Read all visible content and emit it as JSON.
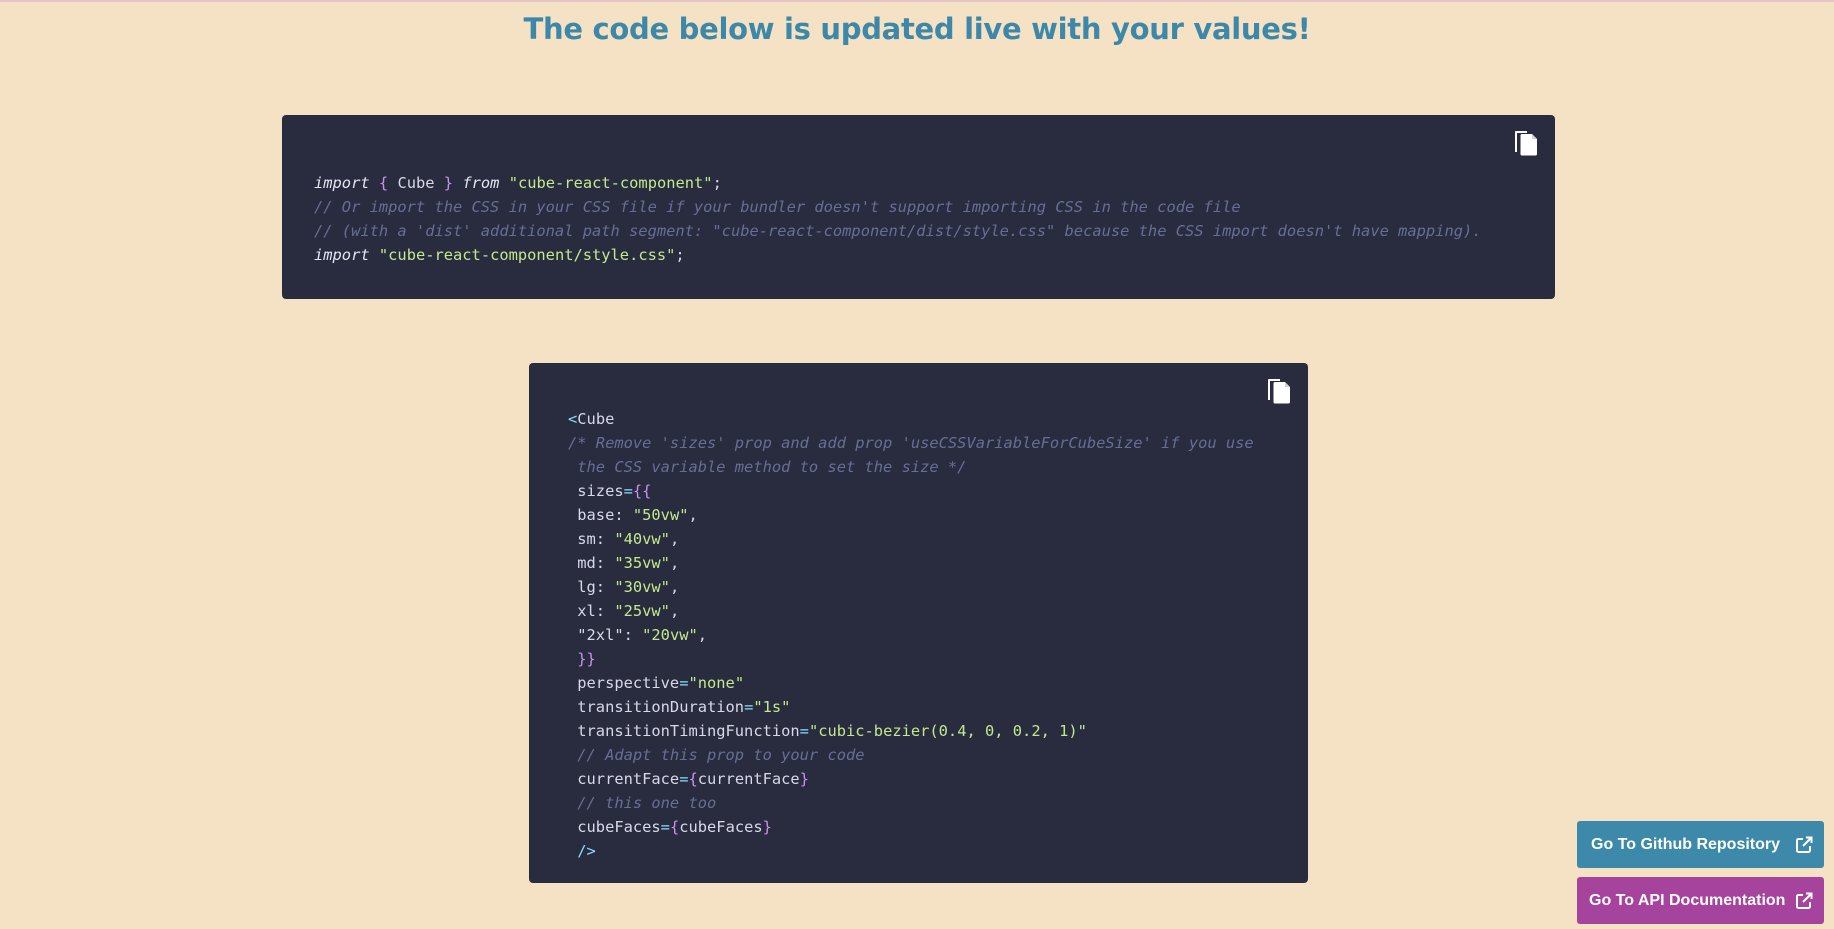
{
  "header": {
    "title": "The code below is updated live with your values!"
  },
  "import_block": {
    "copy_icon": "copy-icon",
    "lines": [
      [
        {
          "t": "import",
          "c": "kw"
        },
        {
          "t": " "
        },
        {
          "t": "{",
          "c": "brace"
        },
        {
          "t": " Cube "
        },
        {
          "t": "}",
          "c": "brace"
        },
        {
          "t": " "
        },
        {
          "t": "from",
          "c": "kw"
        },
        {
          "t": " "
        },
        {
          "t": "\"cube-react-component\"",
          "c": "str"
        },
        {
          "t": ";"
        }
      ],
      [
        {
          "t": "// Or import the CSS in your CSS file if your bundler doesn't support importing CSS in the code file",
          "c": "cmt"
        }
      ],
      [
        {
          "t": "// (with a 'dist' additional path segment: \"cube-react-component/dist/style.css\" because the CSS import doesn't have mapping).",
          "c": "cmt"
        }
      ],
      [
        {
          "t": "import",
          "c": "kw"
        },
        {
          "t": " "
        },
        {
          "t": "\"cube-react-component/style.css\"",
          "c": "str"
        },
        {
          "t": ";"
        }
      ]
    ]
  },
  "cube_block": {
    "copy_icon": "copy-icon",
    "lines": [
      [
        {
          "t": "<",
          "c": "tag"
        },
        {
          "t": "Cube"
        }
      ],
      [
        {
          "t": "/* Remove 'sizes' prop and add prop 'useCSSVariableForCubeSize' if you use",
          "c": "cmt"
        }
      ],
      [
        {
          "t": " the CSS variable method to set the size */",
          "c": "cmt"
        }
      ],
      [
        {
          "t": " sizes"
        },
        {
          "t": "=",
          "c": "tag"
        },
        {
          "t": "{{",
          "c": "brace"
        }
      ],
      [
        {
          "t": " base: "
        },
        {
          "t": "\"50vw\"",
          "c": "str"
        },
        {
          "t": ","
        }
      ],
      [
        {
          "t": " sm: "
        },
        {
          "t": "\"40vw\"",
          "c": "str"
        },
        {
          "t": ","
        }
      ],
      [
        {
          "t": " md: "
        },
        {
          "t": "\"35vw\"",
          "c": "str"
        },
        {
          "t": ","
        }
      ],
      [
        {
          "t": " lg: "
        },
        {
          "t": "\"30vw\"",
          "c": "str"
        },
        {
          "t": ","
        }
      ],
      [
        {
          "t": " xl: "
        },
        {
          "t": "\"25vw\"",
          "c": "str"
        },
        {
          "t": ","
        }
      ],
      [
        {
          "t": " \"2xl\": "
        },
        {
          "t": "\"20vw\"",
          "c": "str"
        },
        {
          "t": ","
        }
      ],
      [
        {
          "t": " "
        },
        {
          "t": "}}",
          "c": "brace"
        }
      ],
      [
        {
          "t": " perspective"
        },
        {
          "t": "=",
          "c": "tag"
        },
        {
          "t": "\"none\"",
          "c": "str"
        }
      ],
      [
        {
          "t": " transitionDuration"
        },
        {
          "t": "=",
          "c": "tag"
        },
        {
          "t": "\"1s\"",
          "c": "str"
        }
      ],
      [
        {
          "t": " transitionTimingFunction"
        },
        {
          "t": "=",
          "c": "tag"
        },
        {
          "t": "\"cubic-bezier(0.4, 0, 0.2, 1)\"",
          "c": "str"
        }
      ],
      [
        {
          "t": " // Adapt this prop to your code",
          "c": "cmt"
        }
      ],
      [
        {
          "t": " currentFace"
        },
        {
          "t": "=",
          "c": "tag"
        },
        {
          "t": "{",
          "c": "brace"
        },
        {
          "t": "currentFace"
        },
        {
          "t": "}",
          "c": "brace"
        }
      ],
      [
        {
          "t": " // this one too",
          "c": "cmt"
        }
      ],
      [
        {
          "t": " cubeFaces"
        },
        {
          "t": "=",
          "c": "tag"
        },
        {
          "t": "{",
          "c": "brace"
        },
        {
          "t": "cubeFaces"
        },
        {
          "t": "}",
          "c": "brace"
        }
      ],
      [
        {
          "t": " "
        },
        {
          "t": "/>",
          "c": "tag"
        }
      ]
    ]
  },
  "buttons": {
    "github_label": "Go To Github Repository",
    "github_icon": "external-link-icon",
    "github_color": "#3c89a9",
    "api_label": "Go To API Documentation",
    "api_icon": "external-link-icon",
    "api_color": "#a6439c"
  },
  "colors": {
    "background": "#f5e1c4",
    "heading": "#3d88a8",
    "code_background": "#292c3e"
  }
}
